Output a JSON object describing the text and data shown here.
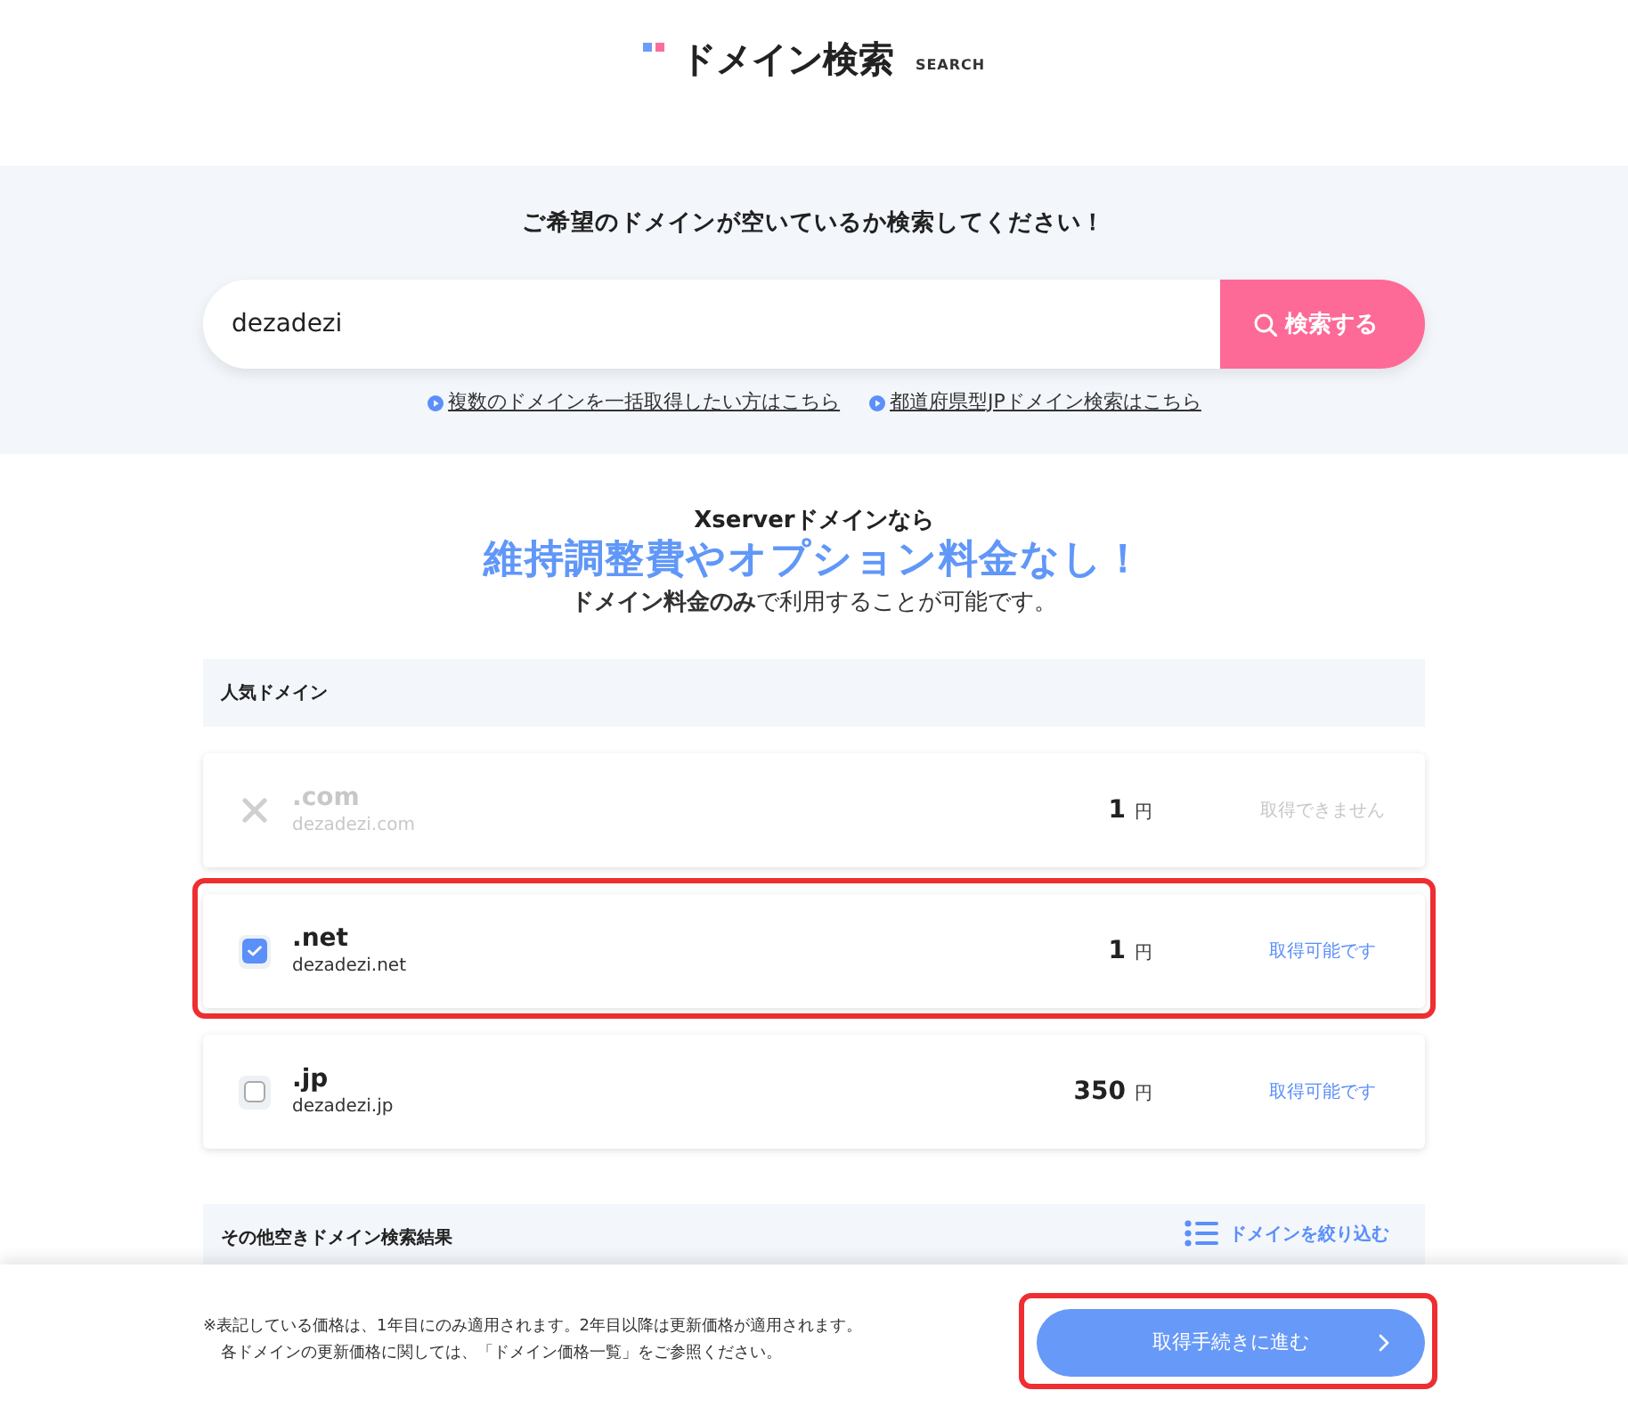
{
  "header": {
    "title": "ドメイン検索",
    "subtitle": "SEARCH"
  },
  "search": {
    "heading": "ご希望のドメインが空いているか検索してください！",
    "value": "dezadezi",
    "button": "検索する",
    "links": [
      "複数のドメインを一括取得したい方はこちら",
      "都道府県型JPドメイン検索はこちら"
    ]
  },
  "promo": {
    "lead": "Xserverドメインなら",
    "headline": "維持調整費やオプション料金なし！",
    "note": "**ドメイン料金のみ**で利用することが可能です。"
  },
  "popular": {
    "title": "人気ドメイン",
    "rows": [
      {
        "tld": ".com",
        "domain": "dezadezi.com",
        "price": "1",
        "unit": "円",
        "status": "取得できません",
        "disabled": true,
        "highlighted": false
      },
      {
        "tld": ".net",
        "domain": "dezadezi.net",
        "price": "1",
        "unit": "円",
        "status": "取得可能です",
        "disabled": false,
        "checked": true,
        "highlighted": true
      },
      {
        "tld": ".jp",
        "domain": "dezadezi.jp",
        "price": "350",
        "unit": "円",
        "status": "取得可能です",
        "disabled": false,
        "checked": false,
        "highlighted": false
      }
    ]
  },
  "other": {
    "title": "その他空きドメイン検索結果",
    "filter": "ドメインを絞り込む"
  },
  "footer": {
    "notes": [
      "※表記している価格は、1年目にのみ適用されます。2年目以降は更新価格が適用されます。",
      "各ドメインの更新価格に関しては、「ドメイン価格一覧」をご参照ください。"
    ],
    "button": {
      "label": "取得手続きに進む",
      "highlighted": true
    }
  }
}
